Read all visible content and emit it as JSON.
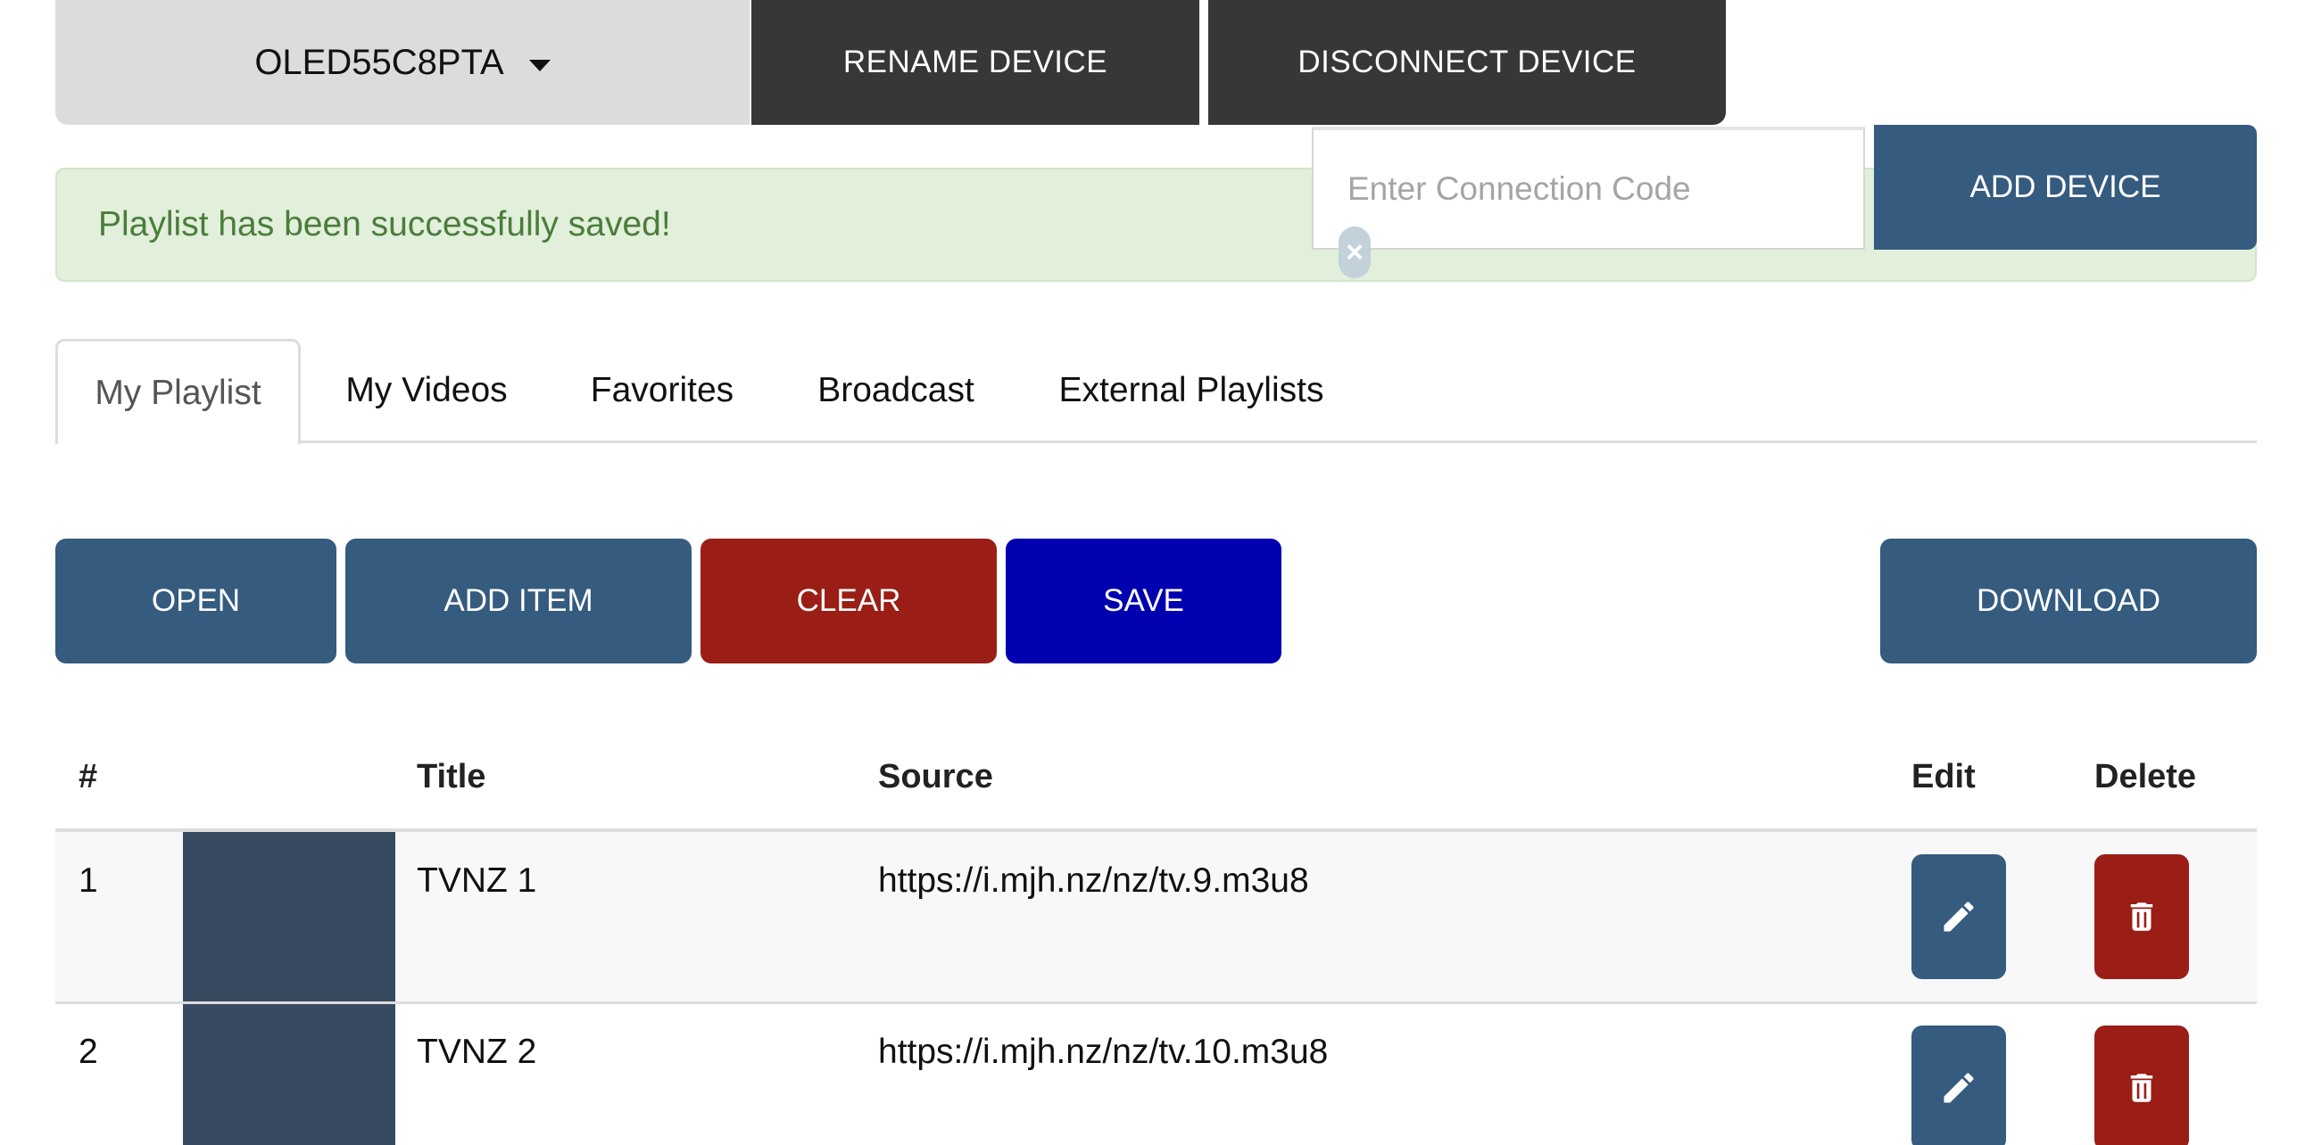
{
  "device_bar": {
    "device_name": "OLED55C8PTA",
    "rename_label": "RENAME DEVICE",
    "disconnect_label": "DISCONNECT DEVICE"
  },
  "alert": {
    "message": "Playlist has been successfully saved!"
  },
  "connection": {
    "placeholder": "Enter Connection Code",
    "value": "",
    "add_device_label": "ADD DEVICE"
  },
  "tabs": [
    {
      "label": "My Playlist",
      "active": true
    },
    {
      "label": "My Videos",
      "active": false
    },
    {
      "label": "Favorites",
      "active": false
    },
    {
      "label": "Broadcast",
      "active": false
    },
    {
      "label": "External Playlists",
      "active": false
    }
  ],
  "toolbar": {
    "open_label": "OPEN",
    "add_item_label": "ADD ITEM",
    "clear_label": "CLEAR",
    "save_label": "SAVE",
    "download_label": "DOWNLOAD"
  },
  "table": {
    "headers": {
      "num": "#",
      "title": "Title",
      "source": "Source",
      "edit": "Edit",
      "delete": "Delete"
    },
    "rows": [
      {
        "num": "1",
        "title": "TVNZ 1",
        "source": "https://i.mjh.nz/nz/tv.9.m3u8"
      },
      {
        "num": "2",
        "title": "TVNZ 2",
        "source": "https://i.mjh.nz/nz/tv.10.m3u8"
      }
    ]
  },
  "colors": {
    "primary": "#355b7f",
    "danger": "#9a1e16",
    "save": "#0100b0",
    "dark": "#373737",
    "success_bg": "#e2efdb",
    "success_text": "#4a7d3b"
  },
  "icons": {
    "edit": "pencil-icon",
    "delete": "trash-icon",
    "dropdown": "caret-down-icon",
    "clear_input": "close-icon"
  }
}
